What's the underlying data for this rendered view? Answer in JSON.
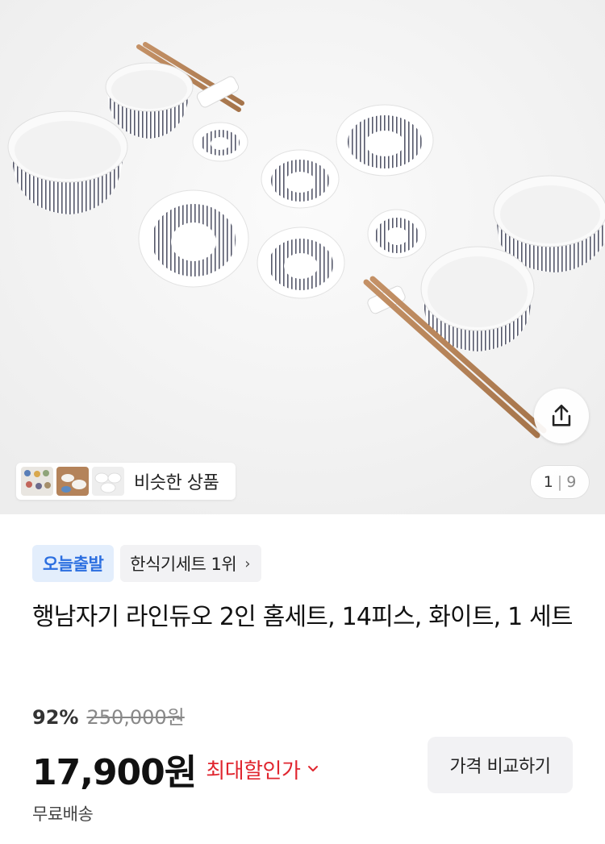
{
  "gallery": {
    "image_alt": "행남자기 라인듀오 2인 홈세트",
    "similar_label": "비슷한 상품",
    "counter_current": "1",
    "counter_sep": "|",
    "counter_total": "9",
    "share_icon": "share-icon"
  },
  "badges": {
    "today": "오늘출발",
    "rank": "한식기세트 1위",
    "rank_chevron": "›"
  },
  "product": {
    "title": "행남자기 라인듀오 2인 홈세트, 14피스, 화이트, 1 세트",
    "discount": "92%",
    "original_price": "250,000원",
    "price": "17,900원",
    "max_discount_label": "최대할인가",
    "max_discount_chevron": "⌄",
    "compare_button": "가격 비교하기",
    "shipping": "무료배송"
  },
  "colors": {
    "accent_blue": "#2c6fe0",
    "badge_blue_bg": "#e3eefc",
    "discount_red": "#e0262f"
  }
}
